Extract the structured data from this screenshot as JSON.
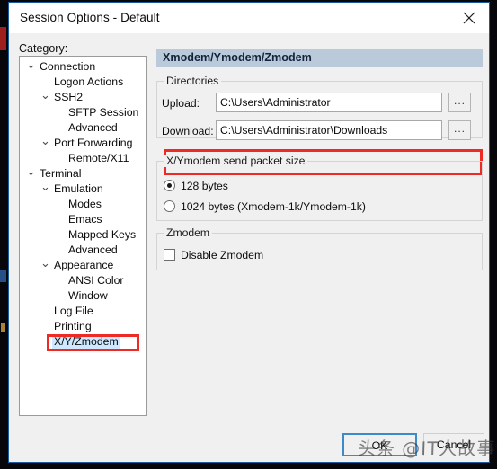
{
  "window": {
    "title": "Session Options - Default",
    "close_icon": "close-icon"
  },
  "category": {
    "label": "Category:",
    "tree": [
      {
        "label": "Connection",
        "depth": 0,
        "chevron": "v",
        "selected": false
      },
      {
        "label": "Logon Actions",
        "depth": 1,
        "chevron": "",
        "selected": false
      },
      {
        "label": "SSH2",
        "depth": 1,
        "chevron": "v",
        "selected": false
      },
      {
        "label": "SFTP Session",
        "depth": 2,
        "chevron": "",
        "selected": false
      },
      {
        "label": "Advanced",
        "depth": 2,
        "chevron": "",
        "selected": false
      },
      {
        "label": "Port Forwarding",
        "depth": 1,
        "chevron": "v",
        "selected": false
      },
      {
        "label": "Remote/X11",
        "depth": 2,
        "chevron": "",
        "selected": false
      },
      {
        "label": "Terminal",
        "depth": 0,
        "chevron": "v",
        "selected": false
      },
      {
        "label": "Emulation",
        "depth": 1,
        "chevron": "v",
        "selected": false
      },
      {
        "label": "Modes",
        "depth": 2,
        "chevron": "",
        "selected": false
      },
      {
        "label": "Emacs",
        "depth": 2,
        "chevron": "",
        "selected": false
      },
      {
        "label": "Mapped Keys",
        "depth": 2,
        "chevron": "",
        "selected": false
      },
      {
        "label": "Advanced",
        "depth": 2,
        "chevron": "",
        "selected": false
      },
      {
        "label": "Appearance",
        "depth": 1,
        "chevron": "v",
        "selected": false
      },
      {
        "label": "ANSI Color",
        "depth": 2,
        "chevron": "",
        "selected": false
      },
      {
        "label": "Window",
        "depth": 2,
        "chevron": "",
        "selected": false
      },
      {
        "label": "Log File",
        "depth": 1,
        "chevron": "",
        "selected": false
      },
      {
        "label": "Printing",
        "depth": 1,
        "chevron": "",
        "selected": false
      },
      {
        "label": "X/Y/Zmodem",
        "depth": 1,
        "chevron": "",
        "selected": true
      }
    ]
  },
  "pane": {
    "header": "Xmodem/Ymodem/Zmodem",
    "directories": {
      "group_title": "Directories",
      "upload_label": "Upload:",
      "upload_value": "C:\\Users\\Administrator",
      "upload_browse": "...",
      "download_label": "Download:",
      "download_value": "C:\\Users\\Administrator\\Downloads",
      "download_browse": "..."
    },
    "packet": {
      "group_title": "X/Ymodem send packet size",
      "option_128": "128 bytes",
      "option_1024": "1024 bytes  (Xmodem-1k/Ymodem-1k)",
      "selected": "128"
    },
    "zmodem": {
      "group_title": "Zmodem",
      "disable_label": "Disable Zmodem",
      "disable_checked": false
    }
  },
  "footer": {
    "ok_label": "OK",
    "cancel_label": "Cancel"
  },
  "overlay": {
    "watermark": "头条 @IT人故事会",
    "highlight_color": "#ee2a24"
  }
}
